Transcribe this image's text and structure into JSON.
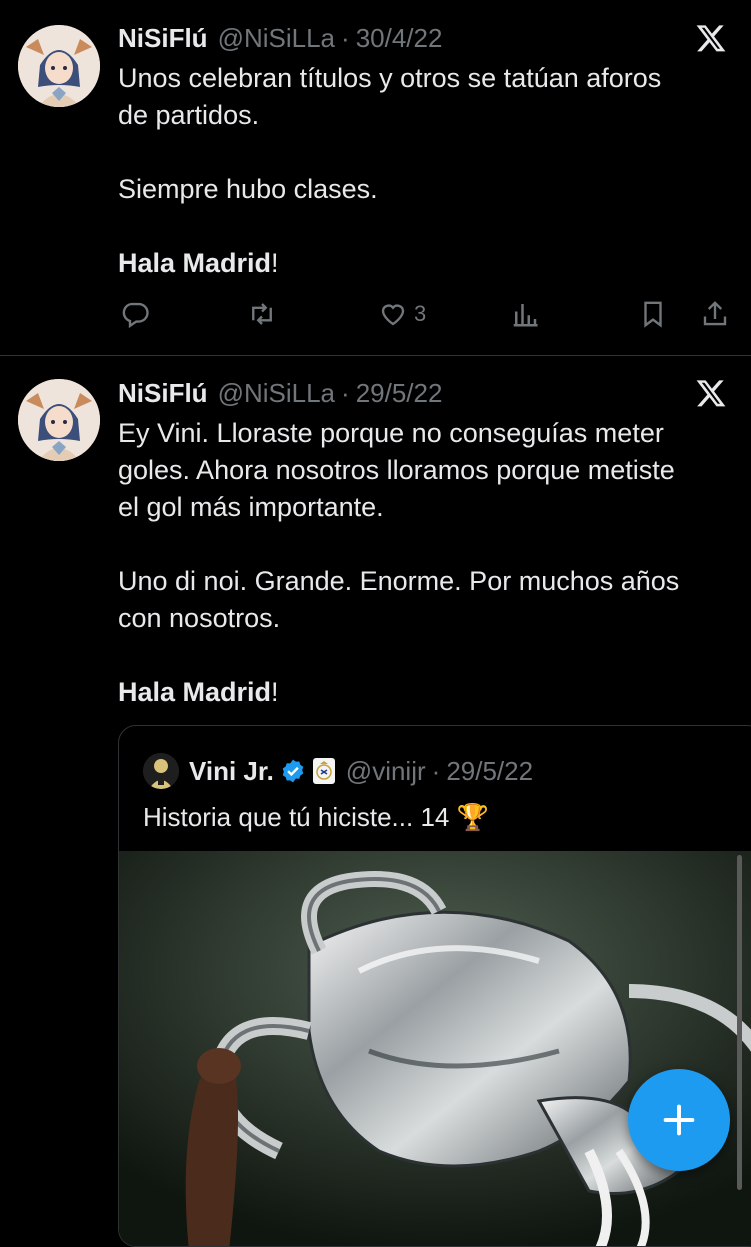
{
  "tweets": [
    {
      "author_name": "NiSiFlú",
      "handle": "@NiSiLLa",
      "separator": "·",
      "date": "30/4/22",
      "lines": [
        "Unos celebran títulos y otros se tatúan aforos",
        "de partidos.",
        "Siempre hubo clases."
      ],
      "closing_bold": "Hala Madrid",
      "closing_rest": "!",
      "likes": "3"
    },
    {
      "author_name": "NiSiFlú",
      "handle": "@NiSiLLa",
      "separator": "·",
      "date": "29/5/22",
      "lines": [
        "Ey Vini. Lloraste porque no conseguías meter",
        "goles. Ahora nosotros lloramos porque metiste",
        "el gol más importante.",
        "Uno di noi. Grande. Enorme. Por muchos años",
        "con nosotros."
      ],
      "closing_bold": "Hala Madrid",
      "closing_rest": "!"
    }
  ],
  "quote": {
    "author_name": "Vini Jr.",
    "handle": "@vinijr",
    "separator": "·",
    "date": "29/5/22",
    "text": "Historia que tú hiciste... 14 🏆"
  },
  "icons": {
    "platform_logo": "x-logo-icon",
    "reply": "reply-icon",
    "repost": "repost-icon",
    "like": "heart-icon",
    "views": "analytics-icon",
    "bookmark": "bookmark-icon",
    "share": "share-icon",
    "compose": "plus-icon",
    "verified": "verified-badge-icon",
    "affiliate": "real-madrid-badge-icon"
  },
  "colors": {
    "background": "#000000",
    "text": "#e7e9ea",
    "muted": "#71767b",
    "accent": "#1d9bf0",
    "divider": "#2f3336"
  }
}
